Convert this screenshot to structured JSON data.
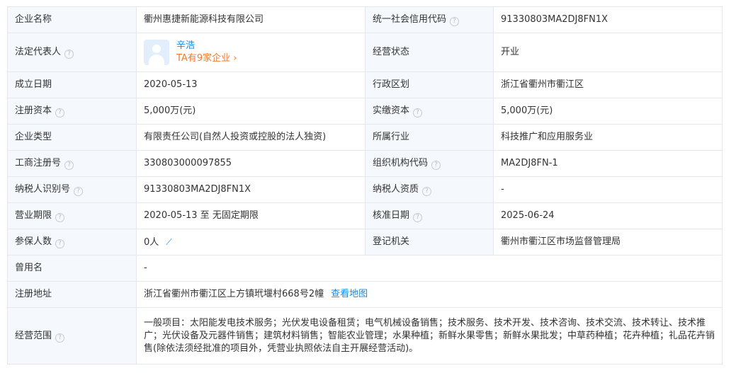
{
  "rows": {
    "company_name": {
      "label": "企业名称",
      "value": "衢州惠捷新能源科技有限公司"
    },
    "credit_code": {
      "label": "统一社会信用代码",
      "value": "91330803MA2DJ8FN1X"
    },
    "legal_rep": {
      "label": "法定代表人",
      "name": "辛浩",
      "company_count": "TA有9家企业 ›"
    },
    "status": {
      "label": "经营状态",
      "value": "开业"
    },
    "established": {
      "label": "成立日期",
      "value": "2020-05-13"
    },
    "region": {
      "label": "行政区划",
      "value": "浙江省衢州市衢江区"
    },
    "reg_capital": {
      "label": "注册资本",
      "value": "5,000万(元)"
    },
    "paid_capital": {
      "label": "实缴资本",
      "value": "5,000万(元)"
    },
    "company_type": {
      "label": "企业类型",
      "value": "有限责任公司(自然人投资或控股的法人独资)"
    },
    "industry": {
      "label": "所属行业",
      "value": "科技推广和应用服务业"
    },
    "reg_number": {
      "label": "工商注册号",
      "value": "330803000097855"
    },
    "org_code": {
      "label": "组织机构代码",
      "value": "MA2DJ8FN-1"
    },
    "taxpayer_id": {
      "label": "纳税人识别号",
      "value": "91330803MA2DJ8FN1X"
    },
    "taxpayer_qual": {
      "label": "纳税人资质",
      "value": "-"
    },
    "term": {
      "label": "营业期限",
      "value": "2020-05-13 至 无固定期限"
    },
    "approval_date": {
      "label": "核准日期",
      "value": "2025-06-24"
    },
    "insured": {
      "label": "参保人数",
      "value": "0人"
    },
    "authority": {
      "label": "登记机关",
      "value": "衢州市衢江区市场监督管理局"
    },
    "former_name": {
      "label": "曾用名",
      "value": "-"
    },
    "address": {
      "label": "注册地址",
      "value": "浙江省衢州市衢江区上方镇玳堰村668号2幢",
      "map_link": "查看地图"
    },
    "scope": {
      "label": "经营范围",
      "value": "一般项目：太阳能发电技术服务；光伏发电设备租赁；电气机械设备销售；技术服务、技术开发、技术咨询、技术交流、技术转让、技术推广；光伏设备及元器件销售；建筑材料销售；智能农业管理；水果种植；新鲜水果零售；新鲜水果批发；中草药种植；花卉种植；礼品花卉销售(除依法须经批准的项目外，凭营业执照依法自主开展经营活动)。"
    }
  },
  "icons": {
    "help": "help-circle-icon",
    "trend": "trend-chart-icon",
    "avatar": "user-avatar-icon"
  },
  "colors": {
    "label_bg": "#f5f8fc",
    "border": "#e4e8ee",
    "link": "#128bed",
    "accent": "#f5792a"
  }
}
